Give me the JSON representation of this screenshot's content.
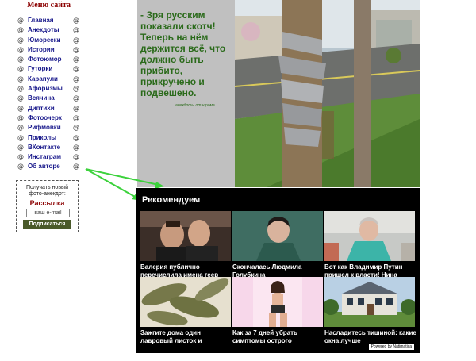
{
  "menu": {
    "title": "Меню сайта",
    "bullet": "@",
    "items": [
      "Главная",
      "Анекдоты",
      "Юморески",
      "Истории",
      "Фотоюмор",
      "Гуторки",
      "Карапули",
      "Афоризмы",
      "Всячина",
      "Диптихи",
      "Фотоочерк",
      "Рифмовки",
      "Приколы",
      "ВКонтакте",
      "Инстаграм",
      "Об авторе"
    ]
  },
  "subscribe": {
    "line1": "Получать новый",
    "line2": "фото-анекдот:",
    "title": "Рассылка",
    "input_value": "ваш e-mail",
    "button": "Подписаться"
  },
  "card": {
    "quote": "- Зря русским показали скотч! Теперь на нём держится всё, что должно быть прибито, прикручено и подвешено.",
    "credit": "анекдоты от н.рома"
  },
  "recommend": {
    "title": "Рекомендуем",
    "tiles": [
      {
        "caption": "Валерия публично перечислила имена геев"
      },
      {
        "caption": "Скончалась Людмила Голубкина"
      },
      {
        "caption": "Вот как Владимир Путин пришел к власти! Нина"
      },
      {
        "caption": "Зажгите дома один лавровый листок и"
      },
      {
        "caption": "Как за 7 дней убрать симптомы острого"
      },
      {
        "caption": "Насладитесь тишиной: какие окна лучше"
      }
    ],
    "powered": "Powered by Natimatica"
  },
  "colors": {
    "menu_link": "#1a1a8c",
    "accent_red": "#8b0000",
    "quote_green": "#2a6a1a",
    "arrow_green": "#3cd23c",
    "panel_bg": "#000000"
  }
}
